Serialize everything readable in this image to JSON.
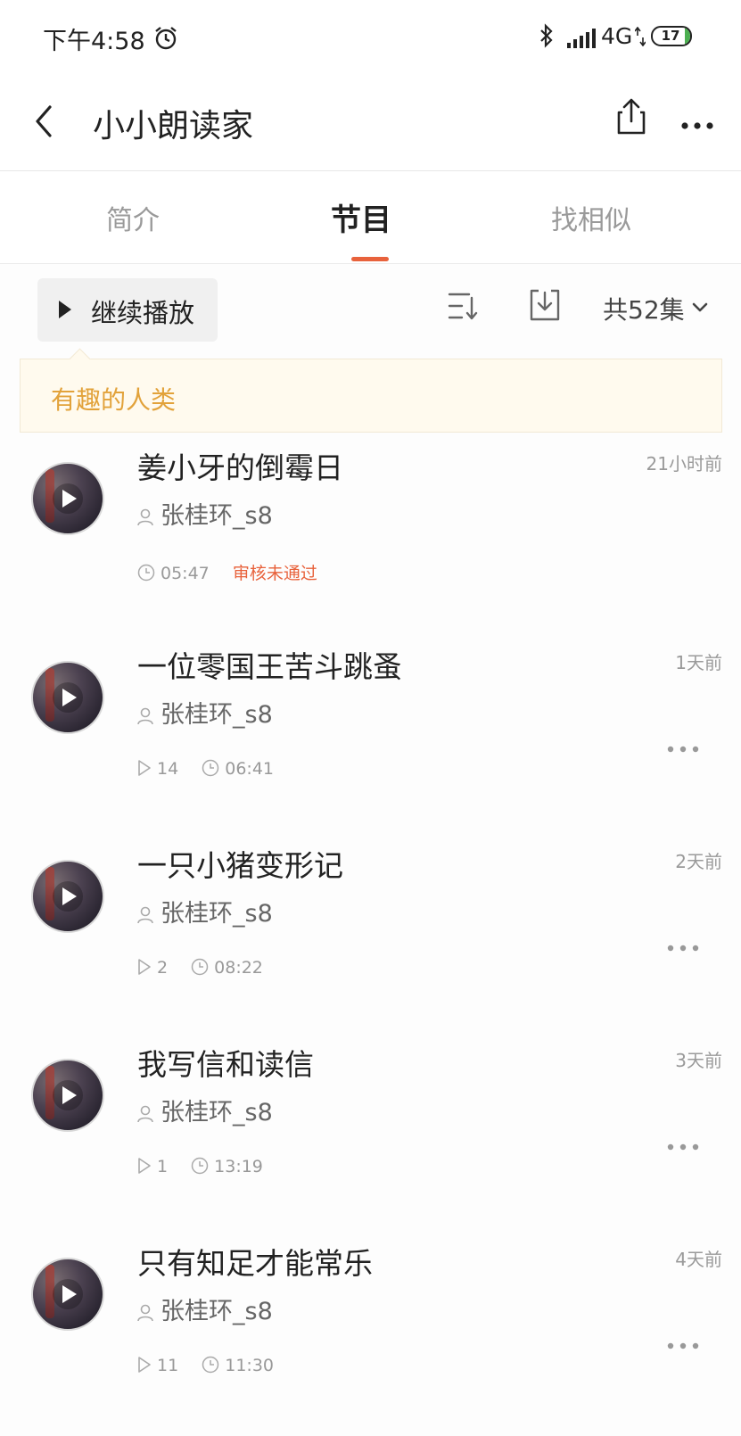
{
  "status_bar": {
    "time": "下午4:58",
    "network": "4G",
    "battery": "17"
  },
  "header": {
    "title": "小小朗读家"
  },
  "tabs": [
    {
      "label": "简介",
      "active": false
    },
    {
      "label": "节目",
      "active": true
    },
    {
      "label": "找相似",
      "active": false
    }
  ],
  "toolbar": {
    "continue_label": "继续播放",
    "count_label": "共52集"
  },
  "notice": {
    "text": "有趣的人类"
  },
  "episodes": [
    {
      "title": "姜小牙的倒霉日",
      "time_ago": "21小时前",
      "author": "张桂环_s8",
      "plays": "",
      "duration": "05:47",
      "status": "审核未通过"
    },
    {
      "title": "一位零国王苦斗跳蚤",
      "time_ago": "1天前",
      "author": "张桂环_s8",
      "plays": "14",
      "duration": "06:41",
      "status": ""
    },
    {
      "title": "一只小猪变形记",
      "time_ago": "2天前",
      "author": "张桂环_s8",
      "plays": "2",
      "duration": "08:22",
      "status": ""
    },
    {
      "title": "我写信和读信",
      "time_ago": "3天前",
      "author": "张桂环_s8",
      "plays": "1",
      "duration": "13:19",
      "status": ""
    },
    {
      "title": "只有知足才能常乐",
      "time_ago": "4天前",
      "author": "张桂环_s8",
      "plays": "11",
      "duration": "11:30",
      "status": ""
    }
  ],
  "colors": {
    "accent": "#e8623c",
    "notice_text": "#e2a23a",
    "notice_bg": "#fffaee"
  }
}
